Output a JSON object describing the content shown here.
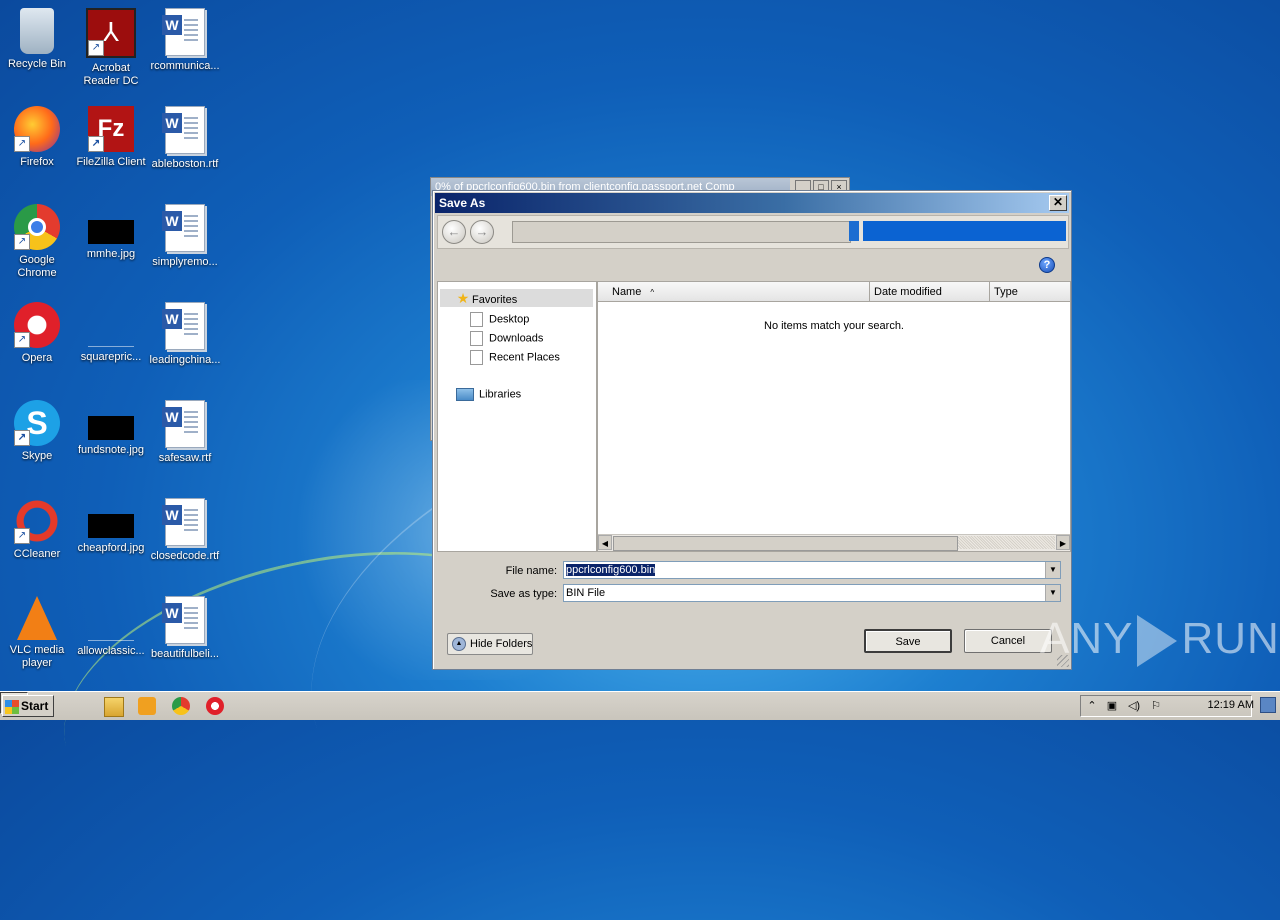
{
  "desktop": {
    "icons": [
      {
        "label": "Recycle Bin"
      },
      {
        "label": "Acrobat Reader DC"
      },
      {
        "label": "rcommunica..."
      },
      {
        "label": "Firefox"
      },
      {
        "label": "FileZilla Client"
      },
      {
        "label": "ableboston.rtf"
      },
      {
        "label": "Google Chrome"
      },
      {
        "label": "mmhe.jpg"
      },
      {
        "label": "simplyremo..."
      },
      {
        "label": "Opera"
      },
      {
        "label": "squarepric..."
      },
      {
        "label": "leadingchina..."
      },
      {
        "label": "Skype"
      },
      {
        "label": "fundsnote.jpg"
      },
      {
        "label": "safesaw.rtf"
      },
      {
        "label": "CCleaner"
      },
      {
        "label": "cheapford.jpg"
      },
      {
        "label": "closedcode.rtf"
      },
      {
        "label": "VLC media player"
      },
      {
        "label": "allowclassic..."
      },
      {
        "label": "beautifulbeli..."
      }
    ]
  },
  "background_window": {
    "title": "0% of ppcrlconfig600.bin from clientconfig.passport.net Comp"
  },
  "dialog": {
    "title": "Save As",
    "close_glyph": "✕",
    "back_glyph": "←",
    "forward_glyph": "→",
    "help_glyph": "?",
    "sidebar": {
      "favorites": "Favorites",
      "items": [
        "Desktop",
        "Downloads",
        "Recent Places"
      ],
      "libraries": "Libraries"
    },
    "columns": [
      "Name",
      "Date modified",
      "Type"
    ],
    "sort_indicator": "^",
    "empty_message": "No items match your search.",
    "file_name_label": "File name:",
    "file_name_value": "ppcrlconfig600.bin",
    "save_type_label": "Save as type:",
    "save_type_value": "BIN File",
    "hide_folders": "Hide Folders",
    "save_button": "Save",
    "cancel_button": "Cancel"
  },
  "watermark": {
    "left": "ANY",
    "right": "RUN"
  },
  "taskbar": {
    "start_label": "Start",
    "clock": "12:19 AM"
  },
  "colors": {
    "desktop_blue": "#0f5fb8",
    "title_bar": "#0a246a",
    "selection": "#0a246a",
    "search_box": "#0b63d2"
  }
}
